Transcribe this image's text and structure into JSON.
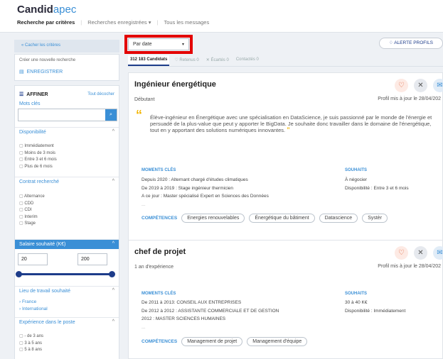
{
  "header": {
    "logo_main": "Candid",
    "logo_accent": "apec",
    "nav": [
      "Recherche par critères",
      "Recherches enregistrées ▾",
      "Tous les messages"
    ]
  },
  "sidebar": {
    "hide_link": "« Cacher les critères",
    "new_search": "Créer une nouvelle recherche",
    "save_label": "ENREGISTRER",
    "refine_label": "AFFINER",
    "clear_all": "Tout décocher",
    "keywords_label": "Mots clés",
    "keywords_value": "",
    "sections": {
      "availability": {
        "title": "Disponibilité",
        "options": [
          "Immédiatement",
          "Moins de 3 mois",
          "Entre 3 et 6 mois",
          "Plus de 6 mois"
        ]
      },
      "contract": {
        "title": "Contrat recherché",
        "options": [
          "Alternance",
          "CDD",
          "CDI",
          "Interim",
          "Stage"
        ]
      },
      "salary": {
        "title": "Salaire souhaité (K€)",
        "min": "20",
        "max": "200"
      },
      "location": {
        "title": "Lieu de travail souhaité",
        "links": [
          "› France",
          "› International"
        ]
      },
      "experience": {
        "title": "Expérience dans le poste",
        "options": [
          "- de 3 ans",
          "3 à 5 ans",
          "5 à 8 ans"
        ]
      }
    }
  },
  "main": {
    "sort_value": "Par date",
    "alert_label": "ALERTE PROFILS",
    "tabs": [
      "312 183 Candidats",
      "Retenus 0",
      "Écartés 0",
      "Contactés 0"
    ],
    "cards": [
      {
        "title": "Ingénieur énergétique",
        "experience": "Débutant",
        "updated": "Profil mis à jour le 28/04/202",
        "quote": "Élève-ingénieur en Énergétique avec une spécialisation en DataScience, je suis passionné par le monde de l'énergie et persuadé de la plus-value que peut y apporter le BigData. Je souhaite donc travailler dans le domaine de l'énergétique, tout en y apportant des solutions numériques innovantes.",
        "moments_title": "MOMENTS CLÉS",
        "moments": [
          "Depuis 2020 : Alternant chargé d'études climatiques",
          "De 2019 à 2019 : Stage ingénieur thermicien",
          "A ce jour : Master spécialisé Expert en Sciences des Données",
          "..."
        ],
        "wishes_title": "SOUHAITS",
        "wishes": [
          "À négocier",
          "Disponibilité : Entre 3 et 6 mois"
        ],
        "skills_label": "COMPÉTENCES",
        "skills": [
          "Energies renouvelables",
          "Énergétique du bâtiment",
          "Datascience",
          "Systèr"
        ]
      },
      {
        "title": "chef de projet",
        "experience": "1 an d'expérience",
        "updated": "Profil mis à jour le 28/04/202",
        "moments_title": "MOMENTS CLÉS",
        "moments": [
          "De 2011 à 2013: CONSEIL AUX ENTREPRISES",
          "De 2012 à 2012 : ASSISTANTE COMMERCIALE ET DE GESTION",
          "2012 : MASTER SCIENCES HUMAINES",
          "..."
        ],
        "wishes_title": "SOUHAITS",
        "wishes": [
          "30 à 40 K€",
          "Disponibilité : Immédiatement"
        ],
        "skills_label": "COMPÉTENCES",
        "skills": [
          "Management de projet",
          "Management d'équipe"
        ]
      }
    ]
  }
}
